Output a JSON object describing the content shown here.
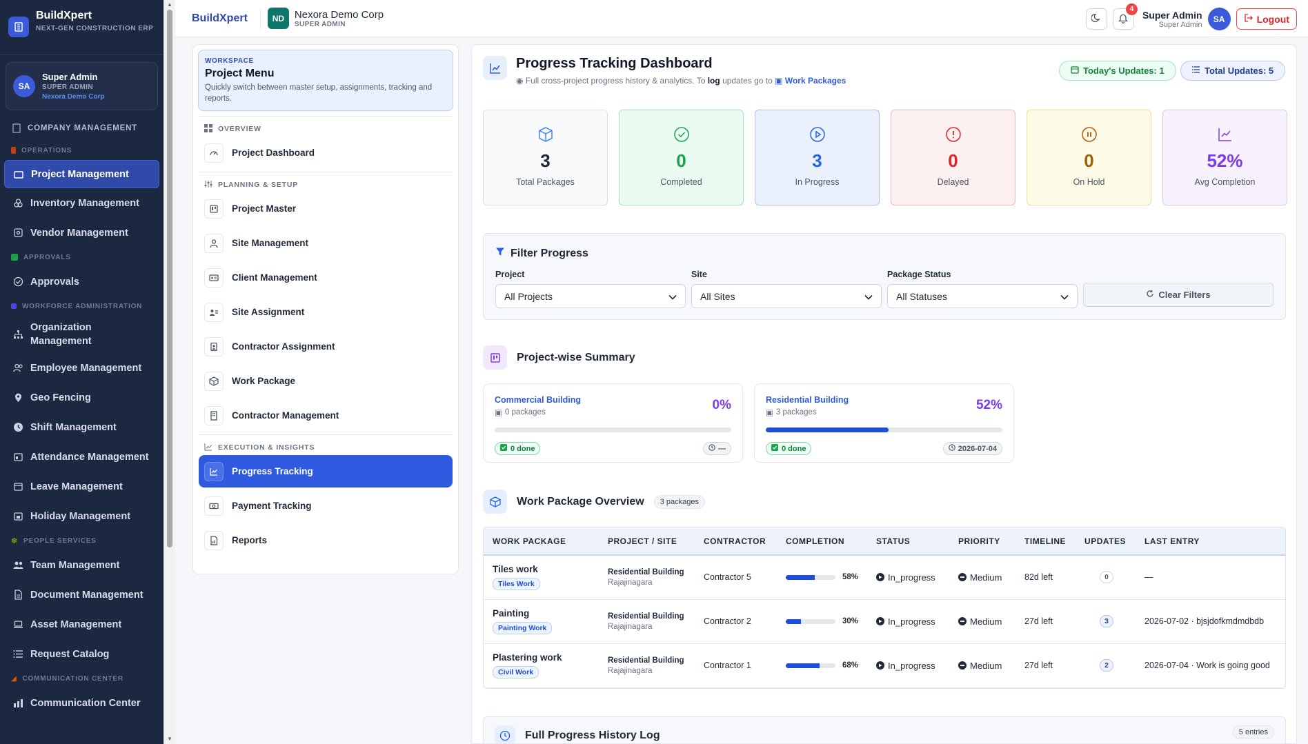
{
  "brand": {
    "name": "BuildXpert",
    "tagline": "NEXT-GEN CONSTRUCTION ERP"
  },
  "sidebar_user": {
    "initials": "SA",
    "name": "Super Admin",
    "role": "SUPER ADMIN",
    "org": "Nexora Demo Corp"
  },
  "sidebar": {
    "company_management": "COMPANY MANAGEMENT",
    "operations": "OPERATIONS",
    "project_management": "Project Management",
    "inventory_management": "Inventory Management",
    "vendor_management": "Vendor Management",
    "approvals_head": "APPROVALS",
    "approvals": "Approvals",
    "workforce_head": "WORKFORCE ADMINISTRATION",
    "organization_management": "Organization Management",
    "employee_management": "Employee Management",
    "geo_fencing": "Geo Fencing",
    "shift_management": "Shift Management",
    "attendance_management": "Attendance Management",
    "leave_management": "Leave Management",
    "holiday_management": "Holiday Management",
    "people_services_head": "PEOPLE SERVICES",
    "team_management": "Team Management",
    "document_management": "Document Management",
    "asset_management": "Asset Management",
    "request_catalog": "Request Catalog",
    "communication_head": "COMMUNICATION CENTER",
    "communication_center": "Communication Center"
  },
  "topbar": {
    "brand": "BuildXpert",
    "org_initials": "ND",
    "org_name": "Nexora Demo Corp",
    "org_role": "SUPER ADMIN",
    "notif_count": "4",
    "user_initials": "SA",
    "user_name": "Super Admin",
    "user_role": "Super Admin",
    "logout": "Logout"
  },
  "project_menu": {
    "ws_tag": "WORKSPACE",
    "ws_title": "Project Menu",
    "ws_desc": "Quickly switch between master setup, assignments, tracking and reports.",
    "overview_head": "OVERVIEW",
    "project_dashboard": "Project Dashboard",
    "planning_head": "PLANNING & SETUP",
    "project_master": "Project Master",
    "site_management": "Site Management",
    "client_management": "Client Management",
    "site_assignment": "Site Assignment",
    "contractor_assignment": "Contractor Assignment",
    "work_package": "Work Package",
    "contractor_management": "Contractor Management",
    "execution_head": "EXECUTION & INSIGHTS",
    "progress_tracking": "Progress Tracking",
    "payment_tracking": "Payment Tracking",
    "reports": "Reports"
  },
  "dashboard": {
    "title": "Progress Tracking Dashboard",
    "subtitle_pre": "Full cross-project progress history & analytics. To",
    "subtitle_bold": "log",
    "subtitle_mid": "updates go to",
    "subtitle_link": "Work Packages",
    "todays_updates": "Today's Updates: 1",
    "total_updates": "Total Updates: 5"
  },
  "stats": [
    {
      "value": "3",
      "label": "Total Packages"
    },
    {
      "value": "0",
      "label": "Completed"
    },
    {
      "value": "3",
      "label": "In Progress"
    },
    {
      "value": "0",
      "label": "Delayed"
    },
    {
      "value": "0",
      "label": "On Hold"
    },
    {
      "value": "52%",
      "label": "Avg Completion"
    }
  ],
  "filters": {
    "title": "Filter Progress",
    "project_label": "Project",
    "project_value": "All Projects",
    "site_label": "Site",
    "site_value": "All Sites",
    "status_label": "Package Status",
    "status_value": "All Statuses",
    "clear": "Clear Filters"
  },
  "project_summary": {
    "title": "Project-wise Summary",
    "cards": [
      {
        "name": "Commercial Building",
        "packages": "0 packages",
        "pct": "0%",
        "progress": 0,
        "done": "0 done",
        "date": "—"
      },
      {
        "name": "Residential Building",
        "packages": "3 packages",
        "pct": "52%",
        "progress": 52,
        "done": "0 done",
        "date": "2026-07-04"
      }
    ]
  },
  "work_packages": {
    "title": "Work Package Overview",
    "count": "3 packages",
    "columns": [
      "WORK PACKAGE",
      "PROJECT / SITE",
      "CONTRACTOR",
      "COMPLETION",
      "STATUS",
      "PRIORITY",
      "TIMELINE",
      "UPDATES",
      "LAST ENTRY"
    ],
    "rows": [
      {
        "name": "Tiles work",
        "tag": "Tiles Work",
        "project": "Residential Building",
        "site": "Rajajinagara",
        "contractor": "Contractor 5",
        "completion": 58,
        "completion_label": "58%",
        "status": "In_progress",
        "priority": "Medium",
        "timeline": "82d left",
        "updates": "0",
        "last_entry": "—"
      },
      {
        "name": "Painting",
        "tag": "Painting Work",
        "project": "Residential Building",
        "site": "Rajajinagara",
        "contractor": "Contractor 2",
        "completion": 30,
        "completion_label": "30%",
        "status": "In_progress",
        "priority": "Medium",
        "timeline": "27d left",
        "updates": "3",
        "last_entry": "2026-07-02 · bjsjdofkmdmdbdb"
      },
      {
        "name": "Plastering work",
        "tag": "Civil Work",
        "project": "Residential Building",
        "site": "Rajajinagara",
        "contractor": "Contractor 1",
        "completion": 68,
        "completion_label": "68%",
        "status": "In_progress",
        "priority": "Medium",
        "timeline": "27d left",
        "updates": "2",
        "last_entry": "2026-07-04 · Work is going good"
      }
    ]
  },
  "history": {
    "title": "Full Progress History Log",
    "entries": "5 entries"
  },
  "colors": {
    "primary": "#2f5ae0",
    "sidebar_bg": "#1c2740",
    "accent_purple": "#7c3aed"
  }
}
